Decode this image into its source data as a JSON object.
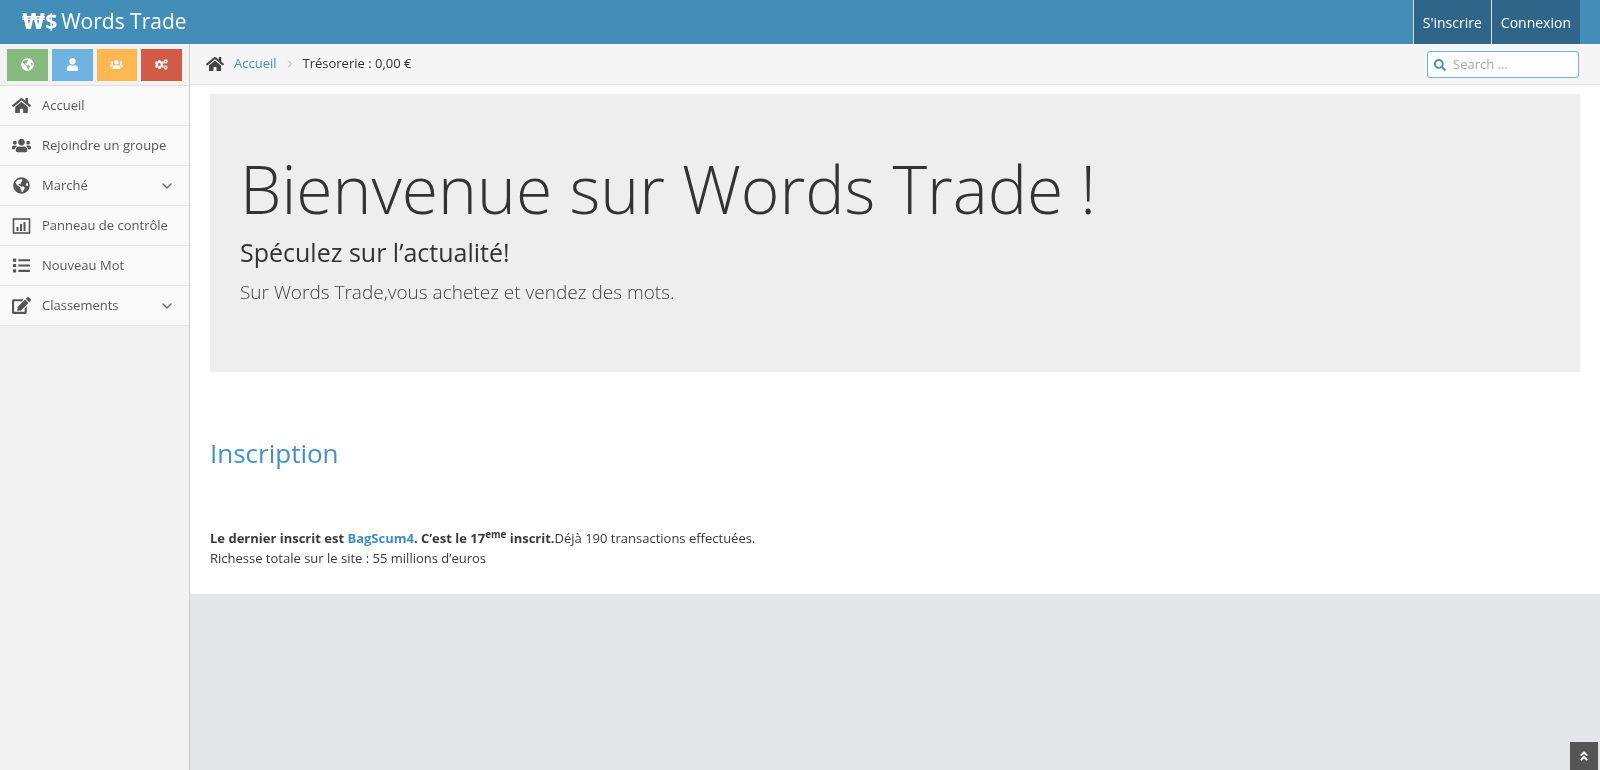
{
  "brand": {
    "logo": "₩$",
    "title": "Words Trade"
  },
  "header_buttons": [
    "S'inscrire",
    "Connexion"
  ],
  "quick_buttons": [
    {
      "color": "#87b87f"
    },
    {
      "color": "#6fb3e0"
    },
    {
      "color": "#ffb752"
    },
    {
      "color": "#d15b47"
    }
  ],
  "sidebar": {
    "items": [
      {
        "label": "Accueil",
        "kind": "link"
      },
      {
        "label": "Rejoindre un groupe",
        "kind": "link"
      },
      {
        "label": "Marché",
        "kind": "submenu"
      },
      {
        "label": "Panneau de contrôle",
        "kind": "link"
      },
      {
        "label": "Nouveau Mot",
        "kind": "link"
      },
      {
        "label": "Classements",
        "kind": "submenu"
      }
    ]
  },
  "breadcrumb": {
    "home": "Accueil",
    "current": "Trésorerie : 0,00 €"
  },
  "search": {
    "placeholder": "Search ..."
  },
  "hero": {
    "title": "Bienvenue sur Words Trade !",
    "subtitle": "Spéculez sur l’actualité!",
    "text": "Sur Words Trade,vous achetez et vendez des mots."
  },
  "section": {
    "title": "Inscription",
    "info": {
      "lead": "Le dernier inscrit est ",
      "link": "BagScum4",
      "bold_after": ". C’est le 17$^{eme}$ inscrit.",
      "rest": "Déjà 190 transactions effectuées."
    },
    "wealth": "Richesse totale sur le site : 55 millions d’euros"
  }
}
